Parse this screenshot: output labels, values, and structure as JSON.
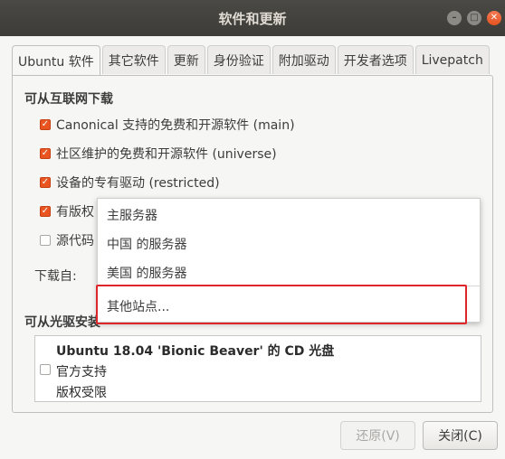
{
  "window": {
    "title": "软件和更新"
  },
  "tabs": [
    "Ubuntu 软件",
    "其它软件",
    "更新",
    "身份验证",
    "附加驱动",
    "开发者选项",
    "Livepatch"
  ],
  "internet": {
    "title": "可从互联网下载",
    "items": [
      {
        "label": "Canonical 支持的免费和开源软件 (main)",
        "checked": true
      },
      {
        "label": "社区维护的免费和开源软件 (universe)",
        "checked": true
      },
      {
        "label": "设备的专有驱动 (restricted)",
        "checked": true
      },
      {
        "label": "有版权",
        "checked": true
      },
      {
        "label": "源代码",
        "checked": false
      }
    ],
    "download_from_label": "下载自:"
  },
  "dropdown": {
    "items": [
      "主服务器",
      "中国 的服务器",
      "美国 的服务器",
      "其他站点..."
    ]
  },
  "cdrom": {
    "title": "可从光驱安装",
    "disc_title": "Ubuntu 18.04 'Bionic Beaver' 的 CD 光盘",
    "line1": "官方支持",
    "line2": "版权受限",
    "checked": false
  },
  "buttons": {
    "revert": "还原(V)",
    "close": "关闭(C)"
  }
}
